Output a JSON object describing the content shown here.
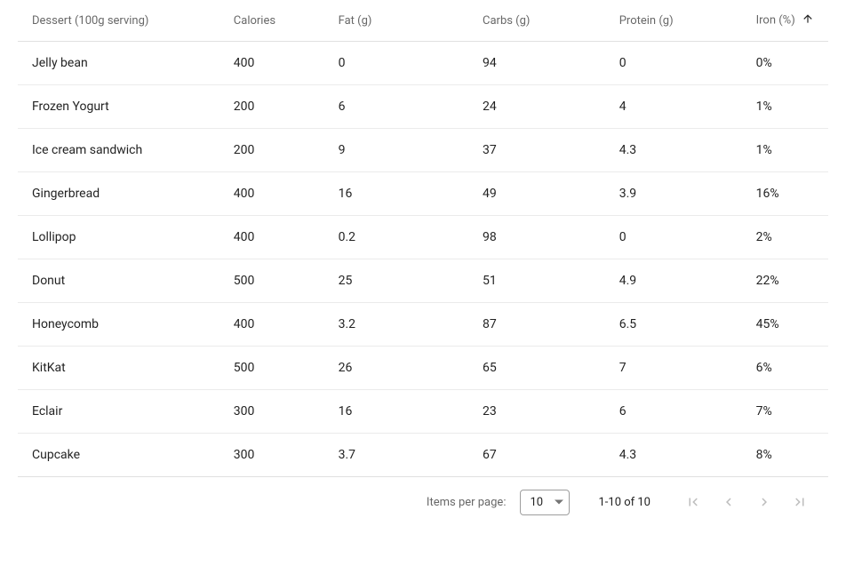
{
  "table": {
    "columns": [
      {
        "label": "Dessert (100g serving)"
      },
      {
        "label": "Calories"
      },
      {
        "label": "Fat (g)"
      },
      {
        "label": "Carbs (g)"
      },
      {
        "label": "Protein (g)"
      },
      {
        "label": "Iron (%)",
        "sorted": "asc"
      }
    ],
    "rows": [
      {
        "dessert": "Jelly bean",
        "calories": "400",
        "fat": "0",
        "carbs": "94",
        "protein": "0",
        "iron": "0%"
      },
      {
        "dessert": "Frozen Yogurt",
        "calories": "200",
        "fat": "6",
        "carbs": "24",
        "protein": "4",
        "iron": "1%"
      },
      {
        "dessert": "Ice cream sandwich",
        "calories": "200",
        "fat": "9",
        "carbs": "37",
        "protein": "4.3",
        "iron": "1%"
      },
      {
        "dessert": "Gingerbread",
        "calories": "400",
        "fat": "16",
        "carbs": "49",
        "protein": "3.9",
        "iron": "16%"
      },
      {
        "dessert": "Lollipop",
        "calories": "400",
        "fat": "0.2",
        "carbs": "98",
        "protein": "0",
        "iron": "2%"
      },
      {
        "dessert": "Donut",
        "calories": "500",
        "fat": "25",
        "carbs": "51",
        "protein": "4.9",
        "iron": "22%"
      },
      {
        "dessert": "Honeycomb",
        "calories": "400",
        "fat": "3.2",
        "carbs": "87",
        "protein": "6.5",
        "iron": "45%"
      },
      {
        "dessert": "KitKat",
        "calories": "500",
        "fat": "26",
        "carbs": "65",
        "protein": "7",
        "iron": "6%"
      },
      {
        "dessert": "Eclair",
        "calories": "300",
        "fat": "16",
        "carbs": "23",
        "protein": "6",
        "iron": "7%"
      },
      {
        "dessert": "Cupcake",
        "calories": "300",
        "fat": "3.7",
        "carbs": "67",
        "protein": "4.3",
        "iron": "8%"
      }
    ]
  },
  "paginator": {
    "items_per_page_label": "Items per page:",
    "page_size": "10",
    "range_label": "1-10 of 10"
  }
}
